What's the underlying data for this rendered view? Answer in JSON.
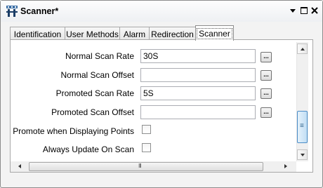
{
  "window": {
    "title": "Scanner*",
    "icon": "scanner-tag-icon"
  },
  "tabs": [
    {
      "label": "Identification"
    },
    {
      "label": "User Methods"
    },
    {
      "label": "Alarm"
    },
    {
      "label": "Redirection"
    },
    {
      "label": "Scanner",
      "active": true
    }
  ],
  "fields": {
    "normal_scan_rate": {
      "label": "Normal Scan Rate",
      "value": "30S",
      "browse": "..."
    },
    "normal_scan_offset": {
      "label": "Normal Scan Offset",
      "value": "",
      "browse": "..."
    },
    "promoted_scan_rate": {
      "label": "Promoted Scan Rate",
      "value": "5S",
      "browse": "..."
    },
    "promoted_scan_offset": {
      "label": "Promoted Scan Offset",
      "value": "",
      "browse": "..."
    }
  },
  "checkboxes": {
    "promote_when_displaying": {
      "label": "Promote when Displaying Points",
      "checked": false
    },
    "always_update": {
      "label": "Always Update On Scan",
      "checked": false
    }
  },
  "scrollbars": {
    "vertical_thumb_grip": "≡",
    "horizontal_thumb_grip": "III"
  }
}
